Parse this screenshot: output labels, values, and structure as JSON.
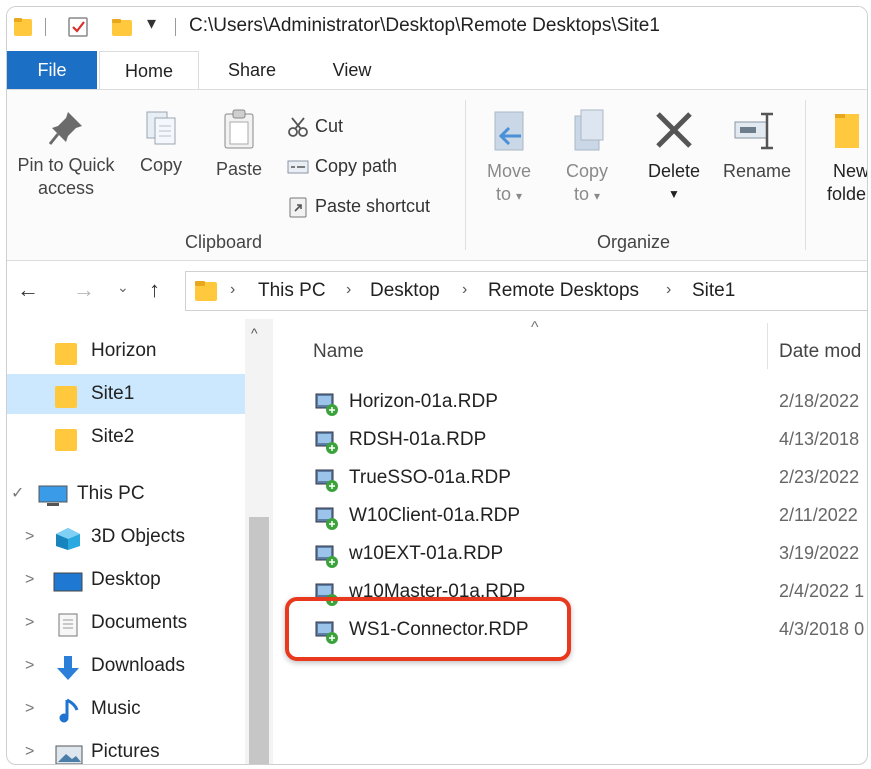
{
  "title_bar": {
    "path": "C:\\Users\\Administrator\\Desktop\\Remote Desktops\\Site1"
  },
  "ribbon_tabs": {
    "file": "File",
    "home": "Home",
    "share": "Share",
    "view": "View"
  },
  "clipboard": {
    "pin_line1": "Pin to Quick",
    "pin_line2": "access",
    "copy": "Copy",
    "paste": "Paste",
    "cut": "Cut",
    "copy_path": "Copy path",
    "paste_shortcut": "Paste shortcut",
    "group_label": "Clipboard"
  },
  "organize": {
    "move_line1": "Move",
    "move_line2": "to",
    "copy_line1": "Copy",
    "copy_line2": "to",
    "delete": "Delete",
    "rename": "Rename",
    "group_label": "Organize"
  },
  "new_group": {
    "new_line1": "New",
    "new_line2": "folde"
  },
  "breadcrumb": {
    "this_pc": "This PC",
    "desktop": "Desktop",
    "remote_desktops": "Remote Desktops",
    "site1": "Site1"
  },
  "nav_pane": {
    "horizon": "Horizon",
    "site1": "Site1",
    "site2": "Site2",
    "this_pc": "This PC",
    "objects_3d": "3D Objects",
    "desktop": "Desktop",
    "documents": "Documents",
    "downloads": "Downloads",
    "music": "Music",
    "pictures": "Pictures"
  },
  "columns": {
    "name": "Name",
    "date": "Date mod"
  },
  "files": [
    {
      "name": "Horizon-01a.RDP",
      "date": "2/18/2022"
    },
    {
      "name": "RDSH-01a.RDP",
      "date": "4/13/2018"
    },
    {
      "name": "TrueSSO-01a.RDP",
      "date": "2/23/2022"
    },
    {
      "name": "W10Client-01a.RDP",
      "date": "2/11/2022"
    },
    {
      "name": "w10EXT-01a.RDP",
      "date": "3/19/2022"
    },
    {
      "name": "w10Master-01a.RDP",
      "date": "2/4/2022 1"
    },
    {
      "name": "WS1-Connector.RDP",
      "date": "4/3/2018 0"
    }
  ],
  "colors": {
    "accent": "#1b6fc4",
    "highlight": "#e8381d",
    "selected_row": "#cce8ff",
    "folder": "#ffc83d"
  },
  "icons": {
    "folder": "folder-icon",
    "rdp": "remote-desktop-file-icon",
    "pc": "computer-icon",
    "objects": "3d-objects-icon",
    "downloads": "download-arrow-icon",
    "music": "music-note-icon",
    "pictures": "pictures-icon",
    "documents": "documents-icon"
  }
}
